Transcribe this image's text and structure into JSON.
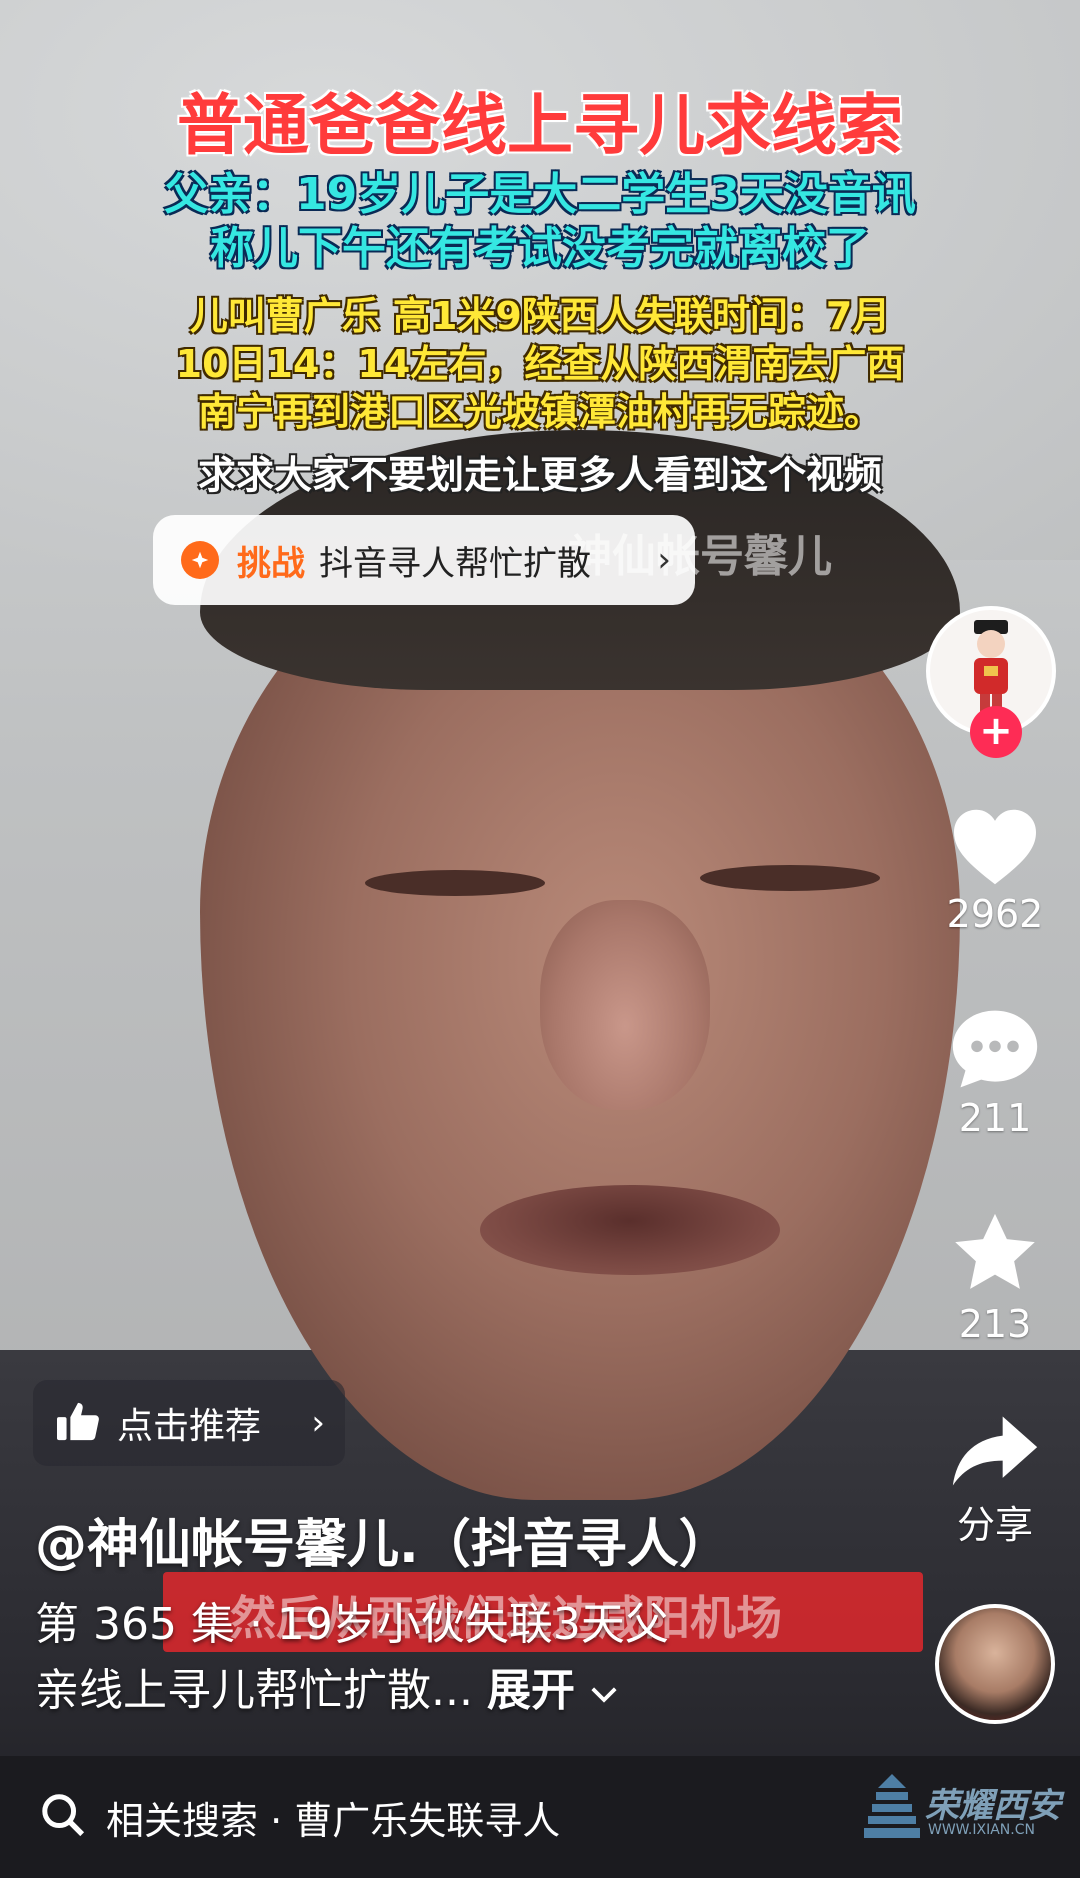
{
  "caption": {
    "title": "普通爸爸线上寻儿求线索",
    "line1": "父亲：19岁儿子是大二学生3天没音讯",
    "line2": "称儿下午还有考试没考完就离校了",
    "yellow1": "儿叫曹广乐  高1米9陕西人失联时间：7月",
    "yellow2": "10日14：14左右，经查从陕西渭南去广西",
    "yellow3": "南宁再到港口区光坡镇潭油村再无踪迹。",
    "white": "求求大家不要划走让更多人看到这个视频",
    "watermark": "神仙帐号馨儿"
  },
  "challenge": {
    "tag": "挑战",
    "text": "抖音寻人帮忙扩散",
    "chevron": "›"
  },
  "rail": {
    "likes": "2962",
    "comments": "211",
    "favorites": "213",
    "share": "分享",
    "follow": "+"
  },
  "recommend": {
    "label": "点击推荐",
    "chevron": "›"
  },
  "author": "@神仙帐号馨儿.（抖音寻人）",
  "description": {
    "line1": "第 365 集 · 19岁小伙失联3天父",
    "line2": "亲线上寻儿帮忙扩散...",
    "more": "展开"
  },
  "burned_subtitle": "然后从西我们这边咸阳机场",
  "search": {
    "text": "相关搜索 · 曹广乐失联寻人"
  },
  "logo": {
    "name": "荣耀西安",
    "url": "WWW.IXIAN.CN"
  },
  "colors": {
    "accent": "#fe2c55",
    "challenge": "#ff6a1a"
  }
}
